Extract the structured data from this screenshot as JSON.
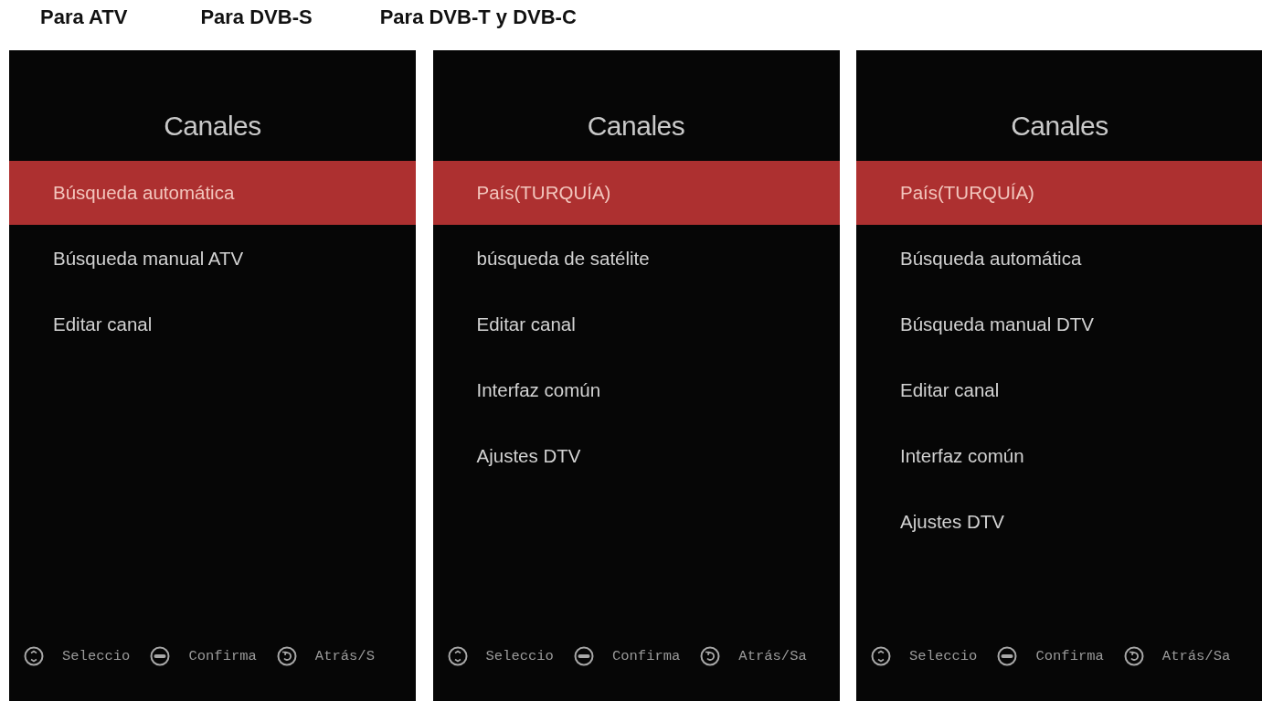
{
  "labels": [
    "Para ATV",
    "Para DVB-S",
    "Para DVB-T y DVB-C"
  ],
  "panels": [
    {
      "title": "Canales",
      "items": [
        {
          "label": "Búsqueda automática",
          "selected": true
        },
        {
          "label": "Búsqueda manual ATV",
          "selected": false
        },
        {
          "label": "Editar canal",
          "selected": false
        }
      ],
      "footer": [
        {
          "kind": "select",
          "label": "Seleccio"
        },
        {
          "kind": "enter",
          "label": "Confirma"
        },
        {
          "kind": "back",
          "label": "Atrás/S"
        }
      ]
    },
    {
      "title": "Canales",
      "items": [
        {
          "label": "País(TURQUÍA)",
          "selected": true
        },
        {
          "label": "búsqueda de satélite",
          "selected": false
        },
        {
          "label": "Editar canal",
          "selected": false
        },
        {
          "label": "Interfaz común",
          "selected": false
        },
        {
          "label": "Ajustes DTV",
          "selected": false
        }
      ],
      "footer": [
        {
          "kind": "select",
          "label": "Seleccio"
        },
        {
          "kind": "enter",
          "label": "Confirma"
        },
        {
          "kind": "back",
          "label": "Atrás/Sa"
        }
      ]
    },
    {
      "title": "Canales",
      "items": [
        {
          "label": "País(TURQUÍA)",
          "selected": true
        },
        {
          "label": "Búsqueda automática",
          "selected": false
        },
        {
          "label": "Búsqueda manual DTV",
          "selected": false
        },
        {
          "label": "Editar canal",
          "selected": false
        },
        {
          "label": "Interfaz común",
          "selected": false
        },
        {
          "label": "Ajustes DTV",
          "selected": false
        }
      ],
      "footer": [
        {
          "kind": "select",
          "label": "Seleccio"
        },
        {
          "kind": "enter",
          "label": "Confirma"
        },
        {
          "kind": "back",
          "label": "Atrás/Sa"
        }
      ]
    }
  ]
}
